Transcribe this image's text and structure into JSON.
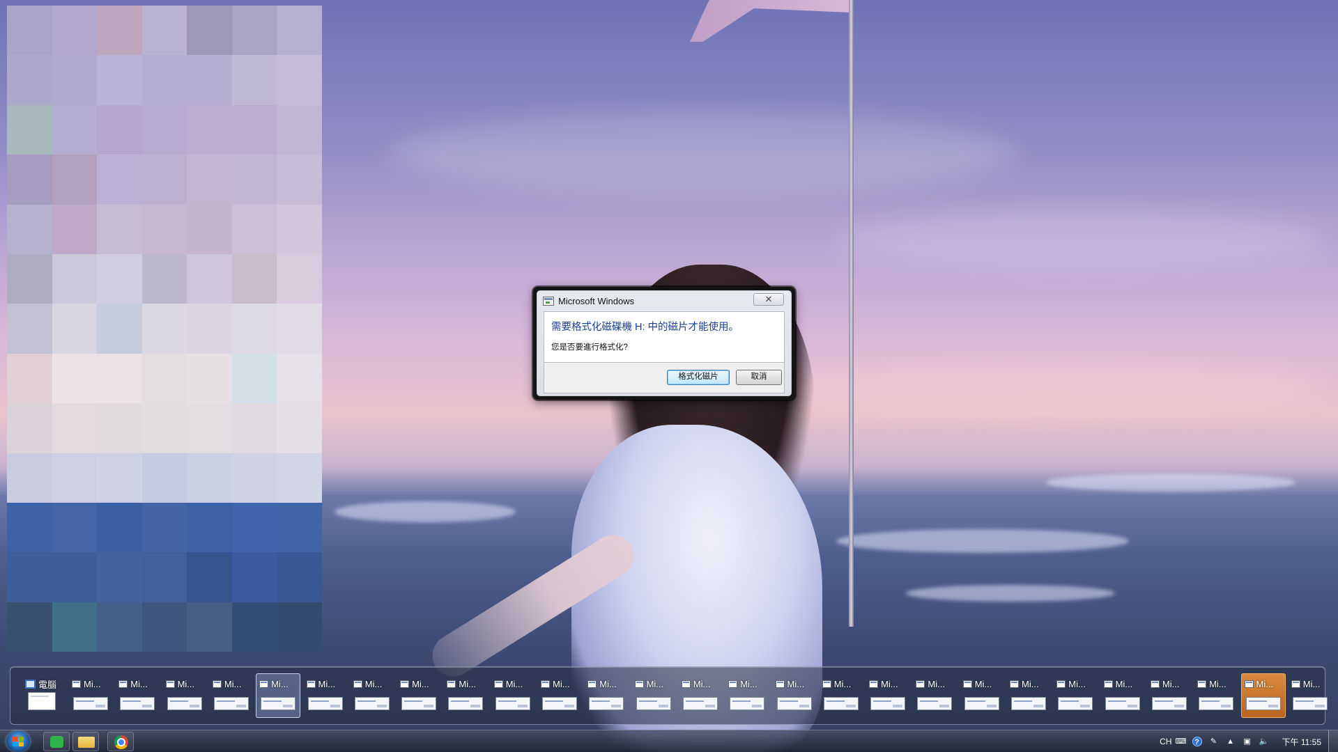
{
  "dialog": {
    "title": "Microsoft Windows",
    "close_glyph": "✕",
    "message": "需要格式化磁碟機 H: 中的磁片才能使用。",
    "question": "您是否要進行格式化?",
    "primary_button": "格式化磁片",
    "cancel_button": "取消"
  },
  "thumbnail_strip": {
    "computer": {
      "label": "電腦"
    },
    "window_label": "Mi...",
    "window_count": 27,
    "active_index": 4,
    "flashing_index": 25
  },
  "taskbar": {
    "pinned": [
      {
        "name": "line",
        "icon": "line-icon"
      },
      {
        "name": "explorer",
        "icon": "folder-icon"
      },
      {
        "name": "chrome",
        "icon": "chrome-icon"
      }
    ],
    "tray": {
      "language": "CH",
      "clock": "下午 11:55"
    }
  },
  "colors": {
    "dialog_message": "#1c3f94",
    "flash_highlight": "#d98a3e",
    "start_orb": "#2c6fb8"
  }
}
